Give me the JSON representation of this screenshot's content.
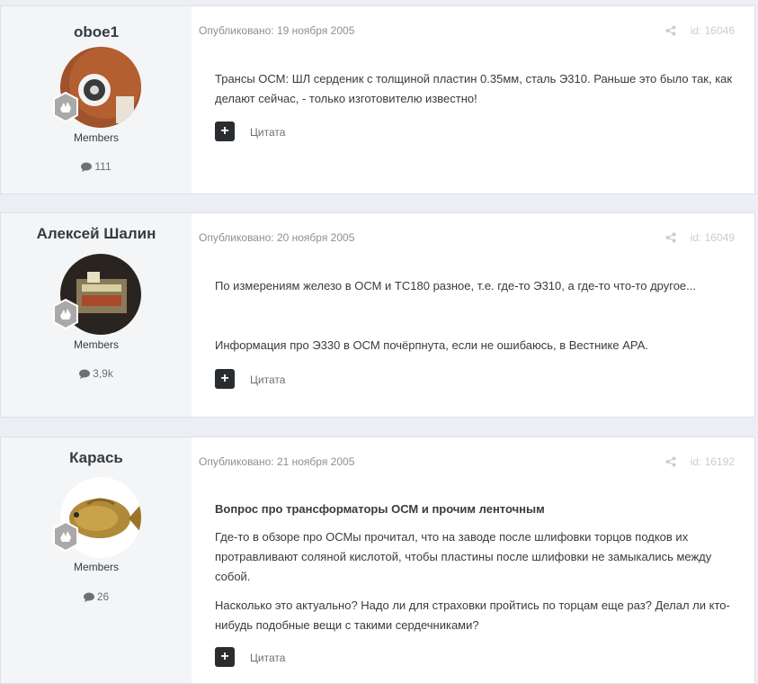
{
  "posts": [
    {
      "author": "oboe1",
      "group": "Members",
      "count": "111",
      "date": "Опубликовано: 19 ноября 2005",
      "id": "id: 16046",
      "paragraphs": [
        "Трансы ОСМ: ШЛ серденик с толщиной пластин 0.35мм, сталь Э310. Раньше это было так, как делают сейчас, - только изготовителю известно!"
      ],
      "quote": "Цитата"
    },
    {
      "author": "Алексей Шалин",
      "group": "Members",
      "count": "3,9k",
      "date": "Опубликовано: 20 ноября 2005",
      "id": "id: 16049",
      "paragraphs": [
        "По измерениям железо в ОСМ и ТС180 разное, т.е. где-то Э310, а где-то что-то другое...",
        "Информация про Э330 в ОСМ почёрпнута, если не ошибаюсь, в Вестнике АРА."
      ],
      "quote": "Цитата"
    },
    {
      "author": "Карась",
      "group": "Members",
      "count": "26",
      "date": "Опубликовано: 21 ноября 2005",
      "id": "id: 16192",
      "heading": "Вопрос про трансформаторы ОСМ и прочим ленточным",
      "paragraphs": [
        "Где-то в обзоре про ОСМы прочитал, что на заводе после шлифовки торцов подков их протравливают соляной кислотой, чтобы пластины после шлифовки не замыкались между собой.",
        "Насколько это актуально? Надо ли для страховки пройтись по торцам еще раз? Делал ли кто-нибудь подобные вещи с такими сердечниками?"
      ],
      "quote": "Цитата"
    }
  ],
  "icons": {
    "count": "comment-bubble-icon",
    "share": "share-icon",
    "rank": "rank-badge-icon",
    "add": "plus-icon"
  },
  "colors": {
    "page_bg": "#ebeef2",
    "author_bg": "#f4f5f7",
    "button_bg": "#2a2d30"
  }
}
